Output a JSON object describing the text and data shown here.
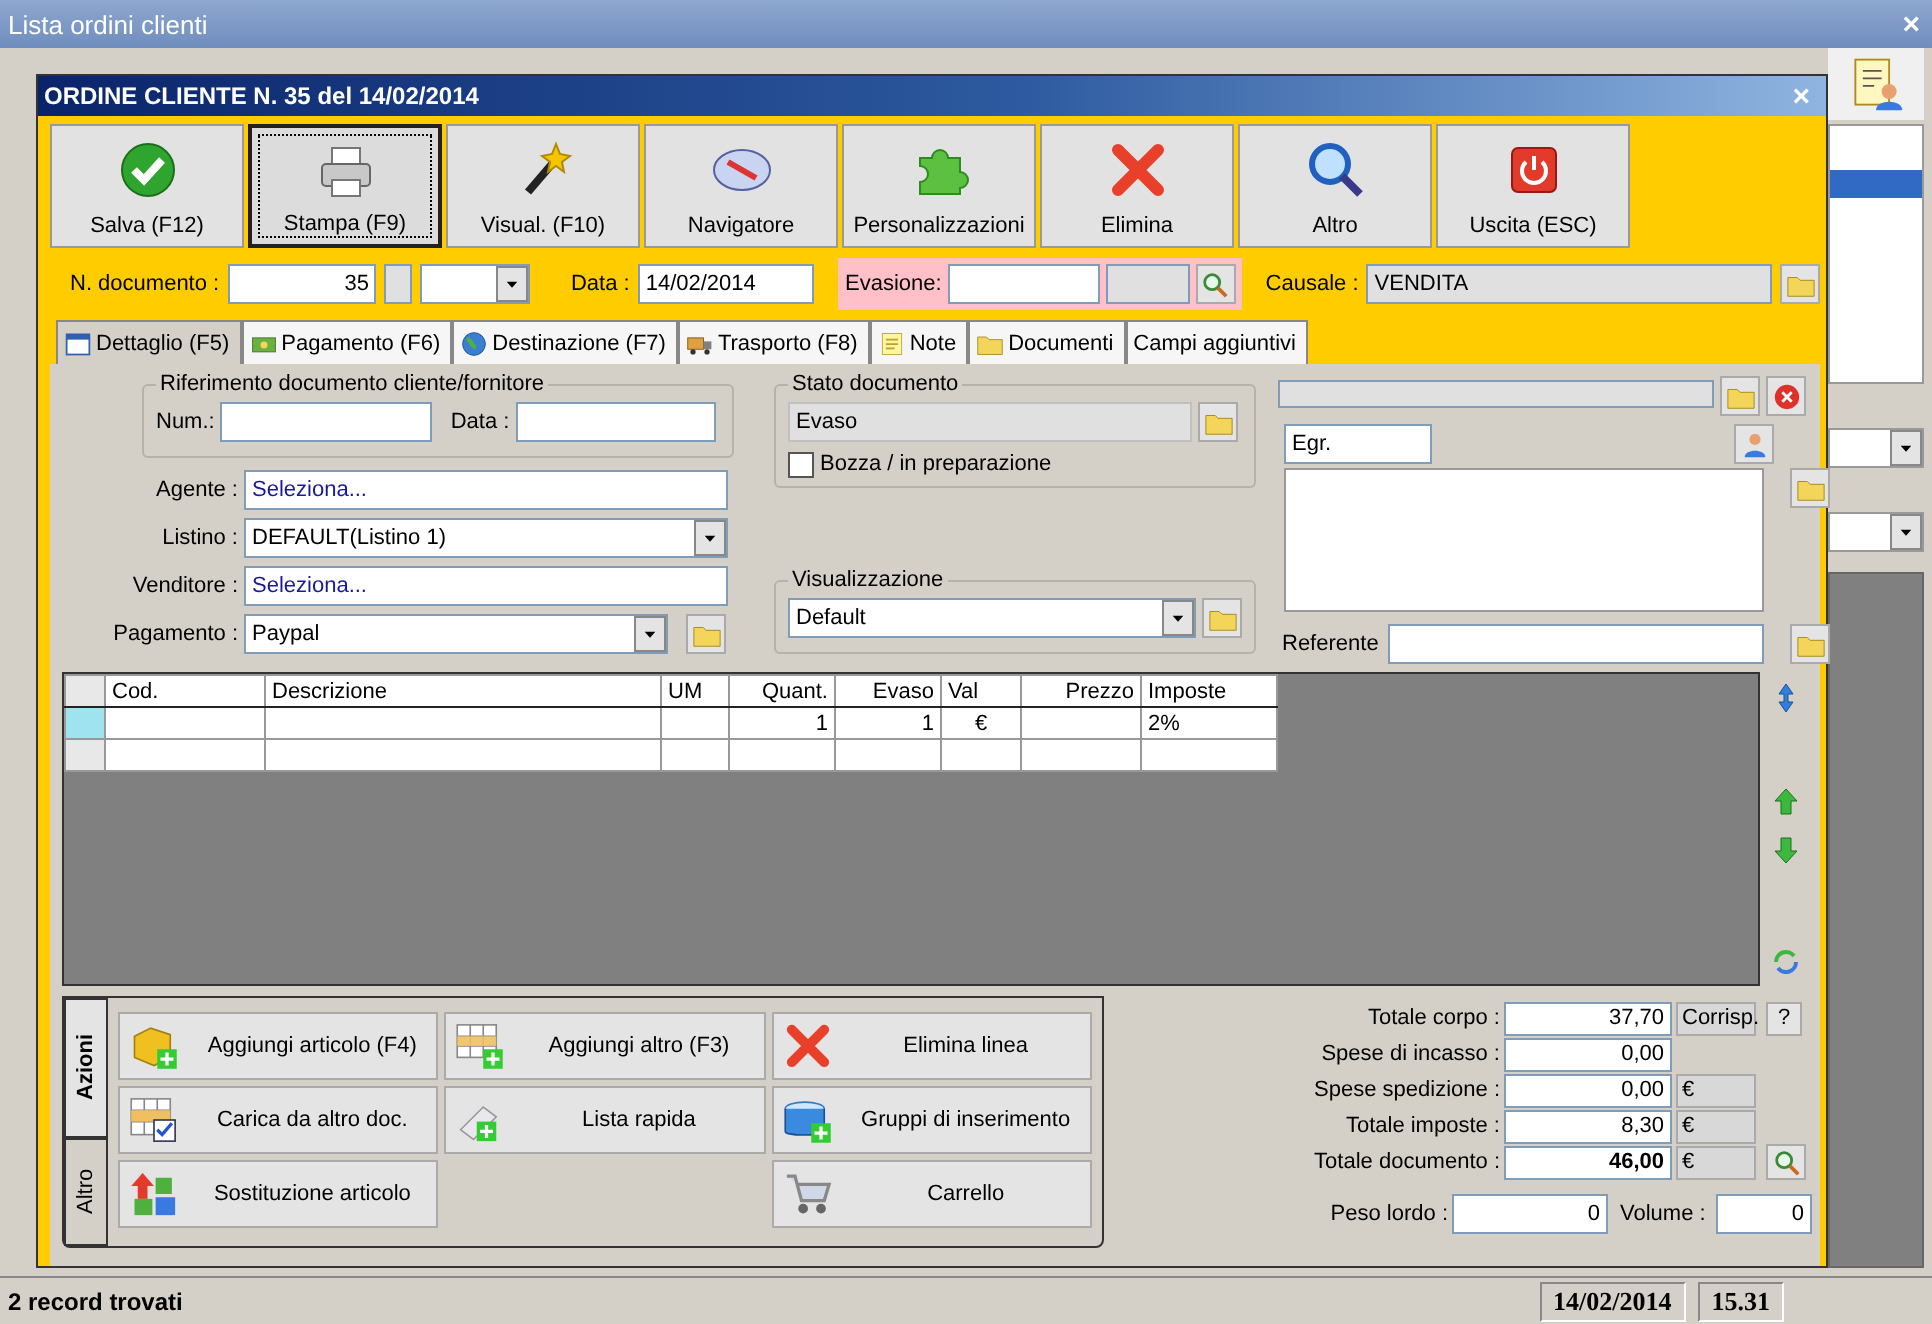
{
  "window": {
    "title": "Lista ordini clienti",
    "close": "×"
  },
  "dialog": {
    "title": "ORDINE CLIENTE N. 35 del 14/02/2014",
    "close": "×"
  },
  "toolbar": [
    {
      "label": "Salva (F12)",
      "selected": false
    },
    {
      "label": "Stampa (F9)",
      "selected": true
    },
    {
      "label": "Visual. (F10)",
      "selected": false
    },
    {
      "label": "Navigatore",
      "selected": false
    },
    {
      "label": "Personalizzazioni",
      "selected": false
    },
    {
      "label": "Elimina",
      "selected": false
    },
    {
      "label": "Altro",
      "selected": false
    },
    {
      "label": "Uscita (ESC)",
      "selected": false
    }
  ],
  "header": {
    "number_label": "N. documento :",
    "number": "35",
    "date_label": "Data :",
    "date": "14/02/2014",
    "fulfillment_label": "Evasione:",
    "reason_label": "Causale :",
    "reason": "VENDITA"
  },
  "tabs": [
    {
      "label": "Dettaglio (F5)",
      "selected": true
    },
    {
      "label": "Pagamento (F6)",
      "selected": false
    },
    {
      "label": "Destinazione (F7)",
      "selected": false
    },
    {
      "label": "Trasporto (F8)",
      "selected": false
    },
    {
      "label": "Note",
      "selected": false
    },
    {
      "label": "Documenti",
      "selected": false
    },
    {
      "label": "Campi aggiuntivi",
      "selected": false
    }
  ],
  "reference": {
    "title": "Riferimento documento cliente/fornitore",
    "number_label": "Num.:",
    "date_label": "Data :"
  },
  "fields": [
    {
      "label": "Agente :",
      "value": "Seleziona...",
      "kind": "lookup"
    },
    {
      "label": "Listino :",
      "value": "DEFAULT(Listino 1)",
      "kind": "dropdown"
    },
    {
      "label": "Venditore :",
      "value": "Seleziona...",
      "kind": "lookup"
    },
    {
      "label": "Pagamento :",
      "value": "Paypal",
      "kind": "dropdown-folder"
    }
  ],
  "document_status": {
    "title": "Stato documento",
    "value": "Evaso",
    "draft_label": "Bozza / in preparazione",
    "draft": false
  },
  "display": {
    "title": "Visualizzazione",
    "value": "Default"
  },
  "customer": {
    "salutation": "Egr.",
    "contact_label": "Referente"
  },
  "grid": {
    "columns": [
      "Cod.",
      "Descrizione",
      "UM",
      "Quant.",
      "Evaso",
      "Val",
      "Prezzo",
      "Imposte"
    ],
    "rows": [
      {
        "selected": true,
        "cells": [
          null,
          null,
          null,
          "1",
          "1",
          "€",
          null,
          "2%"
        ]
      },
      {
        "selected": false,
        "cells": [
          null,
          null,
          null,
          null,
          null,
          null,
          null,
          null
        ]
      }
    ]
  },
  "action_tabs": [
    {
      "label": "Azioni",
      "selected": true
    },
    {
      "label": "Altro",
      "selected": false
    }
  ],
  "action_columns": [
    [
      {
        "label": "Aggiungi articolo (F4)"
      },
      {
        "label": "Carica da altro doc."
      },
      {
        "label": "Sostituzione articolo"
      }
    ],
    [
      {
        "label": "Aggiungi altro (F3)"
      },
      {
        "label": "Lista rapida"
      }
    ],
    [
      {
        "label": "Elimina linea"
      },
      {
        "label": "Gruppi di inserimento"
      },
      {
        "label": "Carrello"
      }
    ]
  ],
  "totals": [
    {
      "label": "Totale corpo :",
      "value": "37,70",
      "kind": "corrisp",
      "suffix": "Corrisp.",
      "button": "?"
    },
    {
      "label": "Spese di incasso :",
      "value": "0,00",
      "kind": "plain"
    },
    {
      "label": "Spese spedizione :",
      "value": "0,00",
      "kind": "currency",
      "suffix": "€"
    },
    {
      "label": "Totale imposte :",
      "value": "8,30",
      "kind": "currency",
      "suffix": "€"
    },
    {
      "label": "Totale documento :",
      "value": "46,00",
      "kind": "total",
      "suffix": "€"
    }
  ],
  "weight": {
    "label": "Peso lordo :",
    "value": "0"
  },
  "volume": {
    "label": "Volume :",
    "value": "0"
  },
  "status_bar": {
    "text": "2 record trovati",
    "date": "14/02/2014",
    "time": "15.31"
  }
}
